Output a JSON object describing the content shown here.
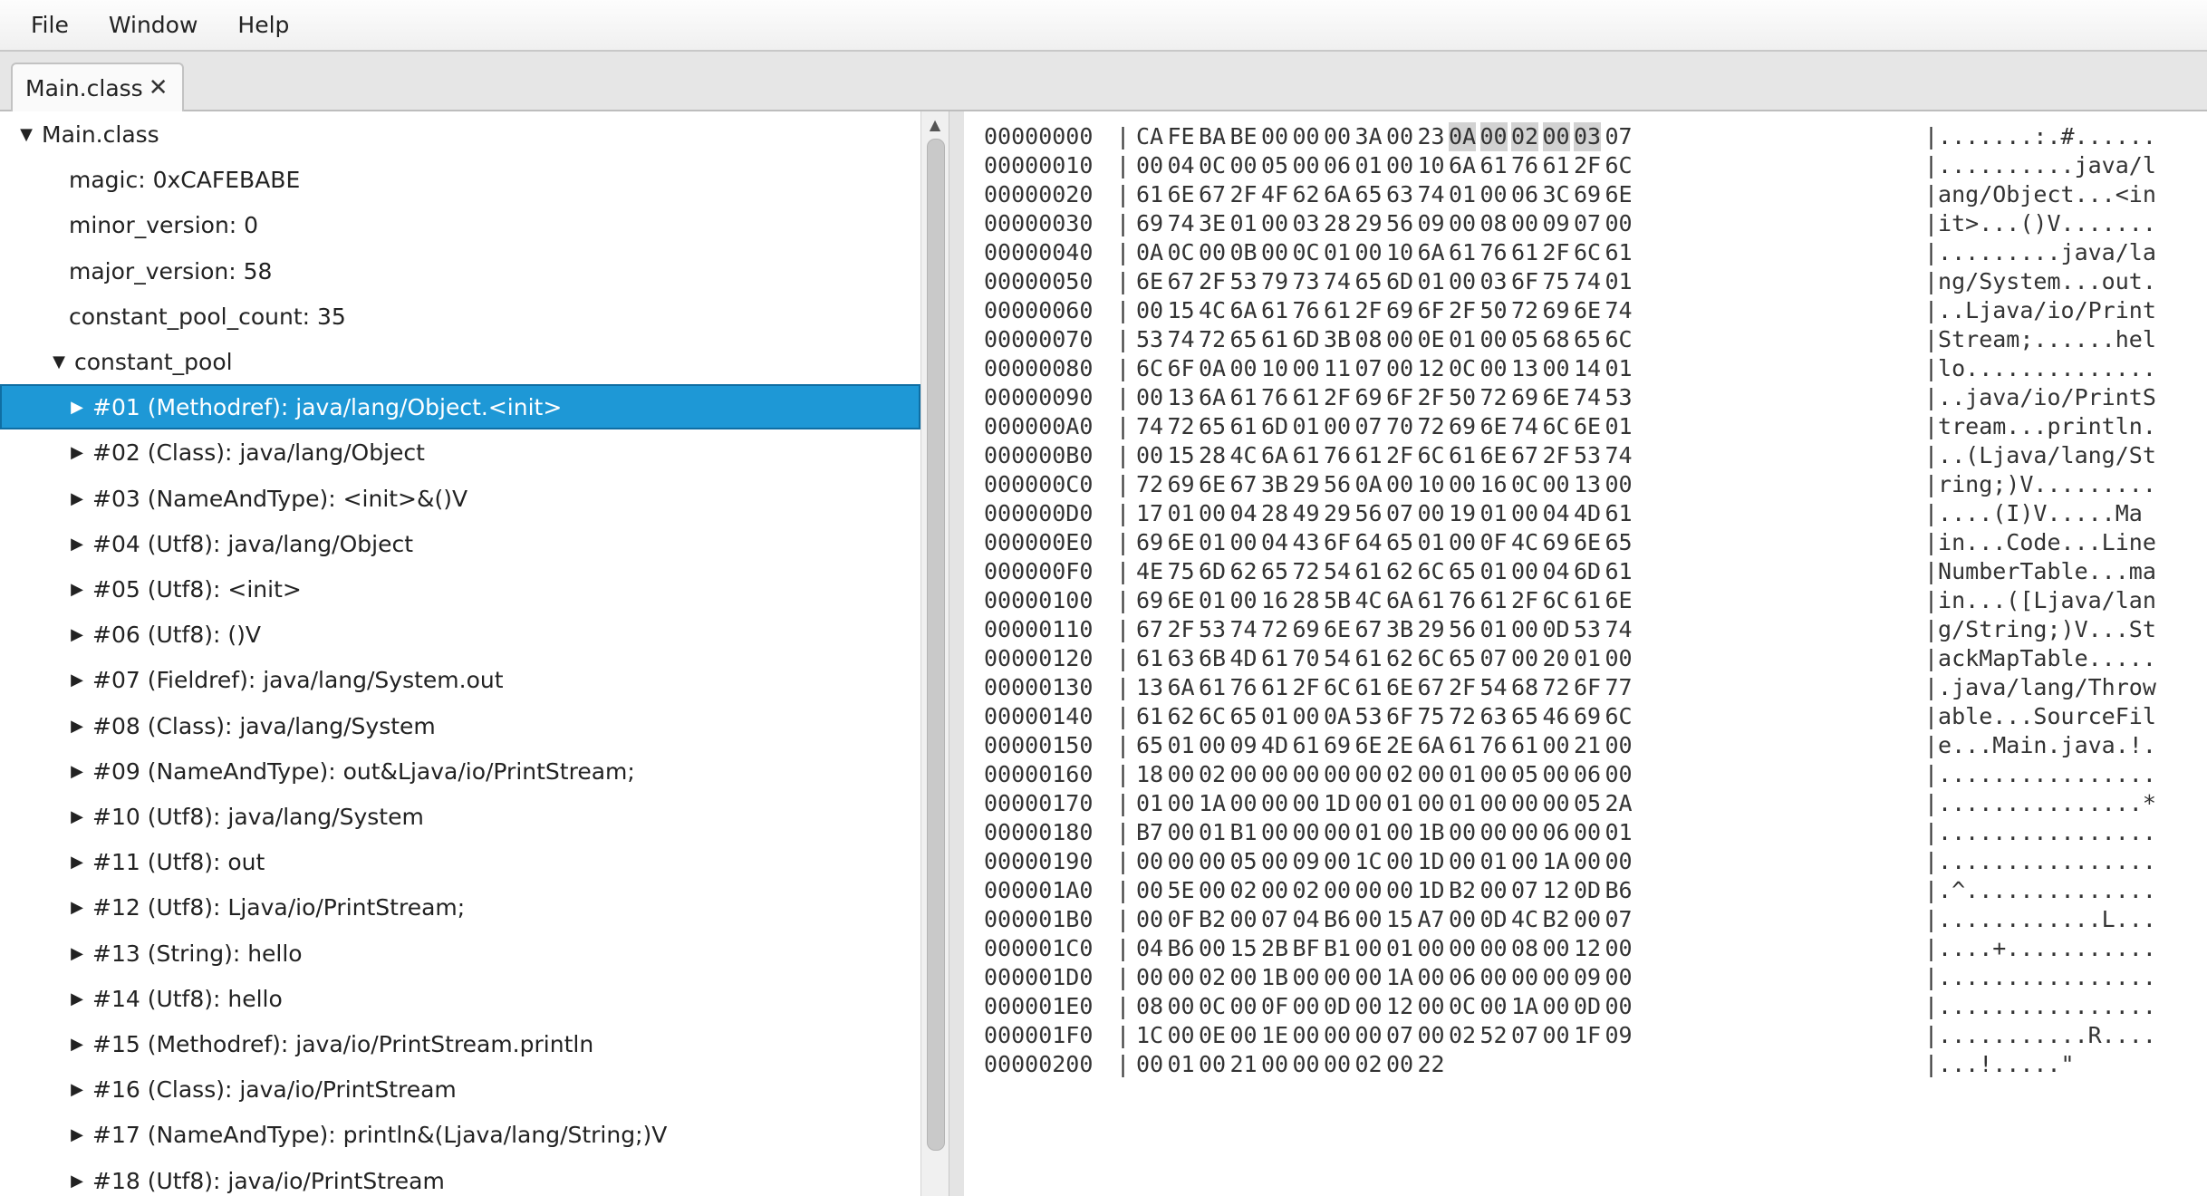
{
  "menu": [
    "File",
    "Window",
    "Help"
  ],
  "tab": {
    "label": "Main.class",
    "close_glyph": "✕"
  },
  "tree": [
    {
      "label": "Main.class",
      "level": 0,
      "arrow": "▼",
      "selected": false
    },
    {
      "label": "magic: 0xCAFEBABE",
      "level": 1,
      "arrow": "",
      "selected": false
    },
    {
      "label": "minor_version: 0",
      "level": 1,
      "arrow": "",
      "selected": false
    },
    {
      "label": "major_version: 58",
      "level": 1,
      "arrow": "",
      "selected": false
    },
    {
      "label": "constant_pool_count: 35",
      "level": 1,
      "arrow": "",
      "selected": false
    },
    {
      "label": "constant_pool",
      "level": 1,
      "arrow": "▼",
      "selected": false
    },
    {
      "label": "#01 (Methodref): java/lang/Object.<init>",
      "level": 2,
      "arrow": "▶",
      "selected": true
    },
    {
      "label": "#02 (Class): java/lang/Object",
      "level": 2,
      "arrow": "▶",
      "selected": false
    },
    {
      "label": "#03 (NameAndType): <init>&()V",
      "level": 2,
      "arrow": "▶",
      "selected": false
    },
    {
      "label": "#04 (Utf8): java/lang/Object",
      "level": 2,
      "arrow": "▶",
      "selected": false
    },
    {
      "label": "#05 (Utf8): <init>",
      "level": 2,
      "arrow": "▶",
      "selected": false
    },
    {
      "label": "#06 (Utf8): ()V",
      "level": 2,
      "arrow": "▶",
      "selected": false
    },
    {
      "label": "#07 (Fieldref): java/lang/System.out",
      "level": 2,
      "arrow": "▶",
      "selected": false
    },
    {
      "label": "#08 (Class): java/lang/System",
      "level": 2,
      "arrow": "▶",
      "selected": false
    },
    {
      "label": "#09 (NameAndType): out&Ljava/io/PrintStream;",
      "level": 2,
      "arrow": "▶",
      "selected": false
    },
    {
      "label": "#10 (Utf8): java/lang/System",
      "level": 2,
      "arrow": "▶",
      "selected": false
    },
    {
      "label": "#11 (Utf8): out",
      "level": 2,
      "arrow": "▶",
      "selected": false
    },
    {
      "label": "#12 (Utf8): Ljava/io/PrintStream;",
      "level": 2,
      "arrow": "▶",
      "selected": false
    },
    {
      "label": "#13 (String): hello",
      "level": 2,
      "arrow": "▶",
      "selected": false
    },
    {
      "label": "#14 (Utf8): hello",
      "level": 2,
      "arrow": "▶",
      "selected": false
    },
    {
      "label": "#15 (Methodref): java/io/PrintStream.println",
      "level": 2,
      "arrow": "▶",
      "selected": false
    },
    {
      "label": "#16 (Class): java/io/PrintStream",
      "level": 2,
      "arrow": "▶",
      "selected": false
    },
    {
      "label": "#17 (NameAndType): println&(Ljava/lang/String;)V",
      "level": 2,
      "arrow": "▶",
      "selected": false
    },
    {
      "label": "#18 (Utf8): java/io/PrintStream",
      "level": 2,
      "arrow": "▶",
      "selected": false
    }
  ],
  "hex": {
    "highlight": {
      "row": 0,
      "start": 9,
      "end": 13
    },
    "rows": [
      {
        "offset": "00000000",
        "bytes": "CA FE BA BE 00 00 00 3A 00 23 0A 00 02 00 03 07",
        "ascii": "|.......:.#......"
      },
      {
        "offset": "00000010",
        "bytes": "00 04 0C 00 05 00 06 01 00 10 6A 61 76 61 2F 6C",
        "ascii": "|..........java/l"
      },
      {
        "offset": "00000020",
        "bytes": "61 6E 67 2F 4F 62 6A 65 63 74 01 00 06 3C 69 6E",
        "ascii": "|ang/Object...<in"
      },
      {
        "offset": "00000030",
        "bytes": "69 74 3E 01 00 03 28 29 56 09 00 08 00 09 07 00",
        "ascii": "|it>...()V......."
      },
      {
        "offset": "00000040",
        "bytes": "0A 0C 00 0B 00 0C 01 00 10 6A 61 76 61 2F 6C 61",
        "ascii": "|.........java/la"
      },
      {
        "offset": "00000050",
        "bytes": "6E 67 2F 53 79 73 74 65 6D 01 00 03 6F 75 74 01",
        "ascii": "|ng/System...out."
      },
      {
        "offset": "00000060",
        "bytes": "00 15 4C 6A 61 76 61 2F 69 6F 2F 50 72 69 6E 74",
        "ascii": "|..Ljava/io/Print"
      },
      {
        "offset": "00000070",
        "bytes": "53 74 72 65 61 6D 3B 08 00 0E 01 00 05 68 65 6C",
        "ascii": "|Stream;......hel"
      },
      {
        "offset": "00000080",
        "bytes": "6C 6F 0A 00 10 00 11 07 00 12 0C 00 13 00 14 01",
        "ascii": "|lo.............."
      },
      {
        "offset": "00000090",
        "bytes": "00 13 6A 61 76 61 2F 69 6F 2F 50 72 69 6E 74 53",
        "ascii": "|..java/io/PrintS"
      },
      {
        "offset": "000000A0",
        "bytes": "74 72 65 61 6D 01 00 07 70 72 69 6E 74 6C 6E 01",
        "ascii": "|tream...println."
      },
      {
        "offset": "000000B0",
        "bytes": "00 15 28 4C 6A 61 76 61 2F 6C 61 6E 67 2F 53 74",
        "ascii": "|..(Ljava/lang/St"
      },
      {
        "offset": "000000C0",
        "bytes": "72 69 6E 67 3B 29 56 0A 00 10 00 16 0C 00 13 00",
        "ascii": "|ring;)V........."
      },
      {
        "offset": "000000D0",
        "bytes": "17 01 00 04 28 49 29 56 07 00 19 01 00 04 4D 61",
        "ascii": "|....(I)V.....Ma"
      },
      {
        "offset": "000000E0",
        "bytes": "69 6E 01 00 04 43 6F 64 65 01 00 0F 4C 69 6E 65",
        "ascii": "|in...Code...Line"
      },
      {
        "offset": "000000F0",
        "bytes": "4E 75 6D 62 65 72 54 61 62 6C 65 01 00 04 6D 61",
        "ascii": "|NumberTable...ma"
      },
      {
        "offset": "00000100",
        "bytes": "69 6E 01 00 16 28 5B 4C 6A 61 76 61 2F 6C 61 6E",
        "ascii": "|in...([Ljava/lan"
      },
      {
        "offset": "00000110",
        "bytes": "67 2F 53 74 72 69 6E 67 3B 29 56 01 00 0D 53 74",
        "ascii": "|g/String;)V...St"
      },
      {
        "offset": "00000120",
        "bytes": "61 63 6B 4D 61 70 54 61 62 6C 65 07 00 20 01 00",
        "ascii": "|ackMapTable....."
      },
      {
        "offset": "00000130",
        "bytes": "13 6A 61 76 61 2F 6C 61 6E 67 2F 54 68 72 6F 77",
        "ascii": "|.java/lang/Throw"
      },
      {
        "offset": "00000140",
        "bytes": "61 62 6C 65 01 00 0A 53 6F 75 72 63 65 46 69 6C",
        "ascii": "|able...SourceFil"
      },
      {
        "offset": "00000150",
        "bytes": "65 01 00 09 4D 61 69 6E 2E 6A 61 76 61 00 21 00",
        "ascii": "|e...Main.java.!."
      },
      {
        "offset": "00000160",
        "bytes": "18 00 02 00 00 00 00 00 02 00 01 00 05 00 06 00",
        "ascii": "|................"
      },
      {
        "offset": "00000170",
        "bytes": "01 00 1A 00 00 00 1D 00 01 00 01 00 00 00 05 2A",
        "ascii": "|...............*"
      },
      {
        "offset": "00000180",
        "bytes": "B7 00 01 B1 00 00 00 01 00 1B 00 00 00 06 00 01",
        "ascii": "|................"
      },
      {
        "offset": "00000190",
        "bytes": "00 00 00 05 00 09 00 1C 00 1D 00 01 00 1A 00 00",
        "ascii": "|................"
      },
      {
        "offset": "000001A0",
        "bytes": "00 5E 00 02 00 02 00 00 00 1D B2 00 07 12 0D B6",
        "ascii": "|.^.............."
      },
      {
        "offset": "000001B0",
        "bytes": "00 0F B2 00 07 04 B6 00 15 A7 00 0D 4C B2 00 07",
        "ascii": "|............L..."
      },
      {
        "offset": "000001C0",
        "bytes": "04 B6 00 15 2B BF B1 00 01 00 00 00 08 00 12 00",
        "ascii": "|....+..........."
      },
      {
        "offset": "000001D0",
        "bytes": "00 00 02 00 1B 00 00 00 1A 00 06 00 00 00 09 00",
        "ascii": "|................"
      },
      {
        "offset": "000001E0",
        "bytes": "08 00 0C 00 0F 00 0D 00 12 00 0C 00 1A 00 0D 00",
        "ascii": "|................"
      },
      {
        "offset": "000001F0",
        "bytes": "1C 00 0E 00 1E 00 00 00 07 00 02 52 07 00 1F 09",
        "ascii": "|...........R...."
      },
      {
        "offset": "00000200",
        "bytes": "00 01 00 21 00 00 00 02 00 22",
        "ascii": "|...!.....\""
      }
    ]
  }
}
